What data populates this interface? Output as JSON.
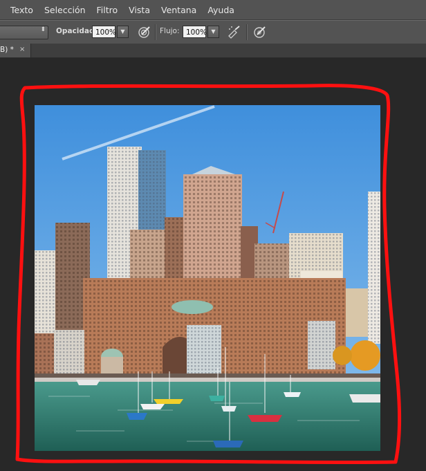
{
  "menu": {
    "items": [
      "Texto",
      "Selección",
      "Filtro",
      "Vista",
      "Ventana",
      "Ayuda"
    ]
  },
  "options": {
    "opacity_label": "Opacidad:",
    "opacity_value": "100%",
    "flow_label": "Flujo:",
    "flow_value": "100%",
    "dropdown_glyph": "▼",
    "spin_glyph": "⬍"
  },
  "tab": {
    "label": "B) *",
    "close": "×"
  },
  "icons": {
    "pressure_opacity": "brush-pressure-icon",
    "airbrush": "airbrush-icon",
    "pressure_size": "brush-pressure-size-icon"
  },
  "colors": {
    "ui_bg": "#535353",
    "canvas_bg": "#282828",
    "annotation": "#ff1010",
    "sky": "#4a92d6",
    "water": "#2f7a70"
  }
}
